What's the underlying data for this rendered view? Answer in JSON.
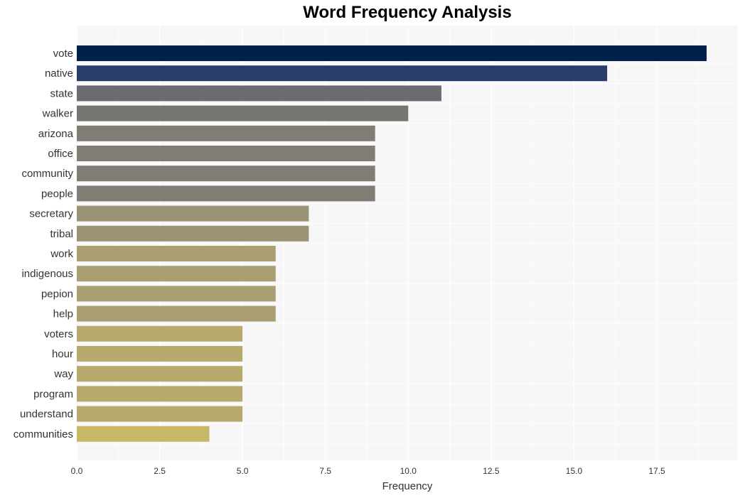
{
  "chart_data": {
    "type": "bar",
    "orientation": "horizontal",
    "title": "Word Frequency Analysis",
    "xlabel": "Frequency",
    "ylabel": "",
    "xlim": [
      0,
      19.9
    ],
    "xticks": [
      0.0,
      2.5,
      5.0,
      7.5,
      10.0,
      12.5,
      15.0,
      17.5
    ],
    "xtick_labels": [
      "0.0",
      "2.5",
      "5.0",
      "7.5",
      "10.0",
      "12.5",
      "15.0",
      "17.5"
    ],
    "grid": true,
    "categories": [
      "vote",
      "native",
      "state",
      "walker",
      "arizona",
      "office",
      "community",
      "people",
      "secretary",
      "tribal",
      "work",
      "indigenous",
      "pepion",
      "help",
      "voters",
      "hour",
      "way",
      "program",
      "understand",
      "communities"
    ],
    "values": [
      19,
      16,
      11,
      10,
      9,
      9,
      9,
      9,
      7,
      7,
      6,
      6,
      6,
      6,
      5,
      5,
      5,
      5,
      5,
      4
    ],
    "colors": [
      "#00204c",
      "#293d6b",
      "#6b6c72",
      "#76756f",
      "#807d74",
      "#807d74",
      "#807d74",
      "#807d74",
      "#9b9474",
      "#9b9474",
      "#aa9f73",
      "#aa9f73",
      "#aa9f73",
      "#aa9f73",
      "#b8a96d",
      "#b8a96d",
      "#b8a96d",
      "#b8a96d",
      "#b8a96d",
      "#c7b867"
    ]
  }
}
